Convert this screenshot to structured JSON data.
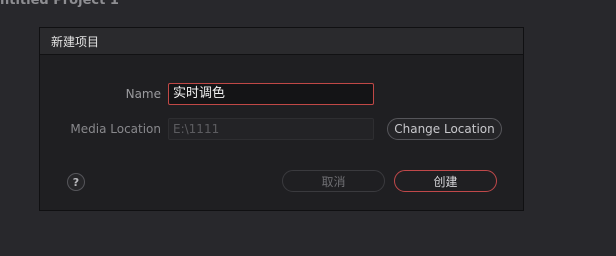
{
  "background": {
    "project_title": "ntitled Project 1"
  },
  "dialog": {
    "title": "新建项目",
    "name_label": "Name",
    "name_value": "实时调色",
    "media_location_label": "Media Location",
    "media_location_value": "E:\\1111",
    "change_location_label": "Change Location",
    "help_label": "?",
    "cancel_label": "取消",
    "create_label": "创建"
  },
  "colors": {
    "accent": "#c0484a",
    "background": "#28282c",
    "dialog": "#1f1f22"
  }
}
